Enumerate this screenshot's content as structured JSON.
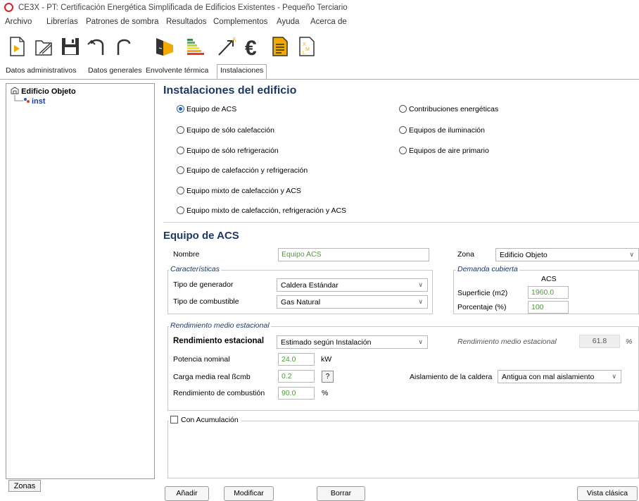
{
  "window": {
    "title": "CE3X - PT: Certificación Energética Simplificada de Edificios Existentes - Pequeño Terciario"
  },
  "menu": [
    "Archivo",
    "Librerías",
    "Patrones de sombra",
    "Resultados",
    "Complementos",
    "Ayuda",
    "Acerca de"
  ],
  "toolbar": {
    "icons": [
      "new-file-icon",
      "open-icon",
      "save-icon",
      "undo-icon",
      "redo-icon",
      "building-icon",
      "energy-rating-icon",
      "improvement-arrow-icon",
      "euro-icon",
      "report-icon",
      "xml-icon"
    ]
  },
  "tabs": [
    "Datos administrativos",
    "Datos generales",
    "Envolvente térmica",
    "Instalaciones"
  ],
  "tree": {
    "root": "Edificio Objeto",
    "child": "inst",
    "zonas_button": "Zonas"
  },
  "instalaciones": {
    "title": "Instalaciones del edificio",
    "options_left": [
      "Equipo de ACS",
      "Equipo de sólo calefacción",
      "Equipo de sólo refrigeración",
      "Equipo de calefacción y refrigeración",
      "Equipo mixto de calefacción y ACS",
      "Equipo mixto de calefacción, refrigeración y ACS"
    ],
    "options_right": [
      "Contribuciones energéticas",
      "Equipos de iluminación",
      "Equipos de aire primario"
    ],
    "selected": "Equipo de ACS"
  },
  "equipo": {
    "title": "Equipo de ACS",
    "nombre_label": "Nombre",
    "nombre_value": "Equipo ACS",
    "zona_label": "Zona",
    "zona_value": "Edificio Objeto",
    "caracteristicas_legend": "Características",
    "tipo_generador_label": "Tipo de generador",
    "tipo_generador_value": "Caldera Estándar",
    "tipo_combustible_label": "Tipo de combustible",
    "tipo_combustible_value": "Gas Natural",
    "demanda_legend": "Demanda cubierta",
    "acs_header": "ACS",
    "superficie_label": "Superficie (m2)",
    "superficie_value": "1960.0",
    "porcentaje_label": "Porcentaje (%)",
    "porcentaje_value": "100"
  },
  "rendimiento": {
    "legend": "Rendimiento medio estacional",
    "estacional_label": "Rendimiento estacional",
    "estacional_value": "Estimado según Instalación",
    "medio_label": "Rendimiento medio estacional",
    "medio_value": "61.8",
    "medio_unit": "%",
    "potencia_label": "Potencia nominal",
    "potencia_value": "24.0",
    "potencia_unit": "kW",
    "carga_label": "Carga media real ßcmb",
    "carga_value": "0.2",
    "help_button": "?",
    "aislamiento_label": "Aislamiento de la caldera",
    "aislamiento_value": "Antigua con mal aislamiento",
    "combustion_label": "Rendimiento de combustión",
    "combustion_value": "90.0",
    "combustion_unit": "%"
  },
  "acumulacion": {
    "label": "Con Acumulación",
    "checked": false
  },
  "buttons": {
    "anadir": "Añadir",
    "modificar": "Modificar",
    "borrar": "Borrar",
    "vista_clasica": "Vista clásica"
  }
}
